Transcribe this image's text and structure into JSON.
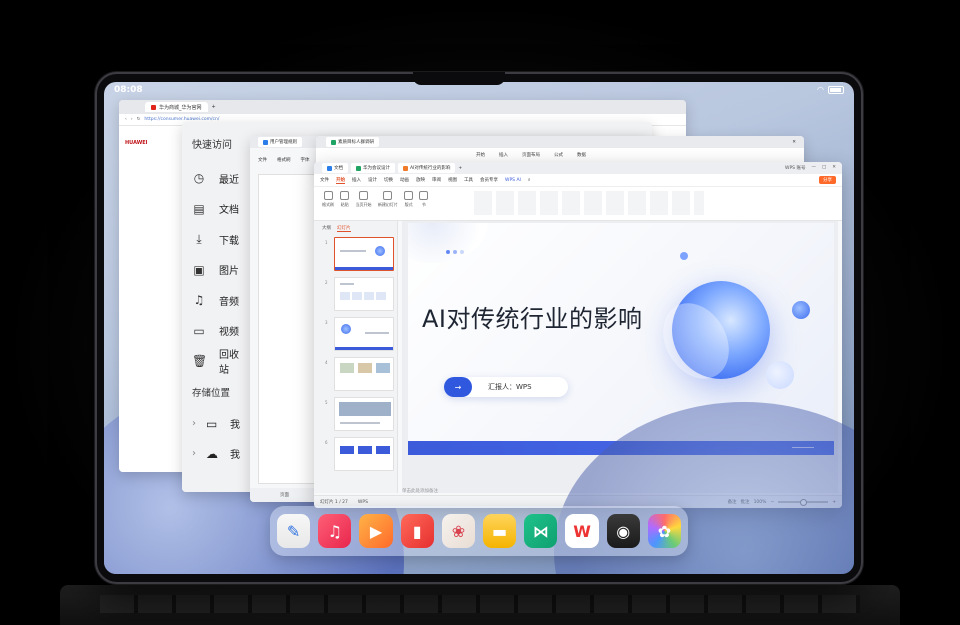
{
  "status": {
    "time": "08:08"
  },
  "browser": {
    "tab_title": "华为商城_华为官网",
    "url": "https://consumer.huawei.com/cn/",
    "brand": "HUAWEI"
  },
  "files": {
    "quick_access_title": "快速访问",
    "items": [
      {
        "icon": "clock-icon",
        "label": "最近"
      },
      {
        "icon": "document-icon",
        "label": "文档"
      },
      {
        "icon": "download-icon",
        "label": "下载"
      },
      {
        "icon": "image-icon",
        "label": "图片"
      },
      {
        "icon": "music-icon",
        "label": "音频"
      },
      {
        "icon": "video-icon",
        "label": "视频"
      },
      {
        "icon": "trash-icon",
        "label": "回收站"
      }
    ],
    "storage_title": "存储位置",
    "drives": [
      {
        "icon": "tablet-icon",
        "label": "我"
      },
      {
        "icon": "cloud-icon",
        "label": "我"
      }
    ]
  },
  "writer": {
    "tab_title": "用户管理规则",
    "file_label": "文件",
    "format_painter": "格式刷",
    "font_label": "字体",
    "page_label": "页面"
  },
  "sheet": {
    "tab_title": "素质目标人群调研",
    "menu": [
      "开始",
      "插入",
      "页面布局",
      "公式",
      "数据"
    ]
  },
  "ppt": {
    "tabs": [
      "文档",
      "华为会议设计"
    ],
    "active_tab": "AI对传统行业的影响",
    "account": "WPS 账号",
    "menu": [
      "文件",
      "开始",
      "插入",
      "设计",
      "切换",
      "动画",
      "放映",
      "审阅",
      "视图",
      "工具",
      "会员专享"
    ],
    "active_menu": "开始",
    "wps_ai": "WPS AI",
    "share": "分享",
    "ribbon": [
      "格式刷",
      "粘贴",
      "当页开始",
      "新建幻灯片",
      "版式",
      "节"
    ],
    "thumb_tabs": [
      "大纲",
      "幻灯片"
    ],
    "active_thumb_tab": "幻灯片",
    "slide_count": 6,
    "slide": {
      "title": "AI对传统行业的影响",
      "reporter": "汇报人：WPS"
    },
    "notes_placeholder": "单击此处添加备注",
    "statusbar": {
      "page": "幻灯片 1 / 27",
      "theme": "WPS",
      "notes": "备注",
      "comments": "批注",
      "zoom": "100%"
    }
  },
  "dock": {
    "apps": [
      "notes-app-icon",
      "music-app-icon",
      "video-app-icon",
      "books-app-icon",
      "lotus-app-icon",
      "files-app-icon",
      "code-app-icon",
      "wps-app-icon",
      "camera-app-icon",
      "gallery-app-icon"
    ]
  }
}
